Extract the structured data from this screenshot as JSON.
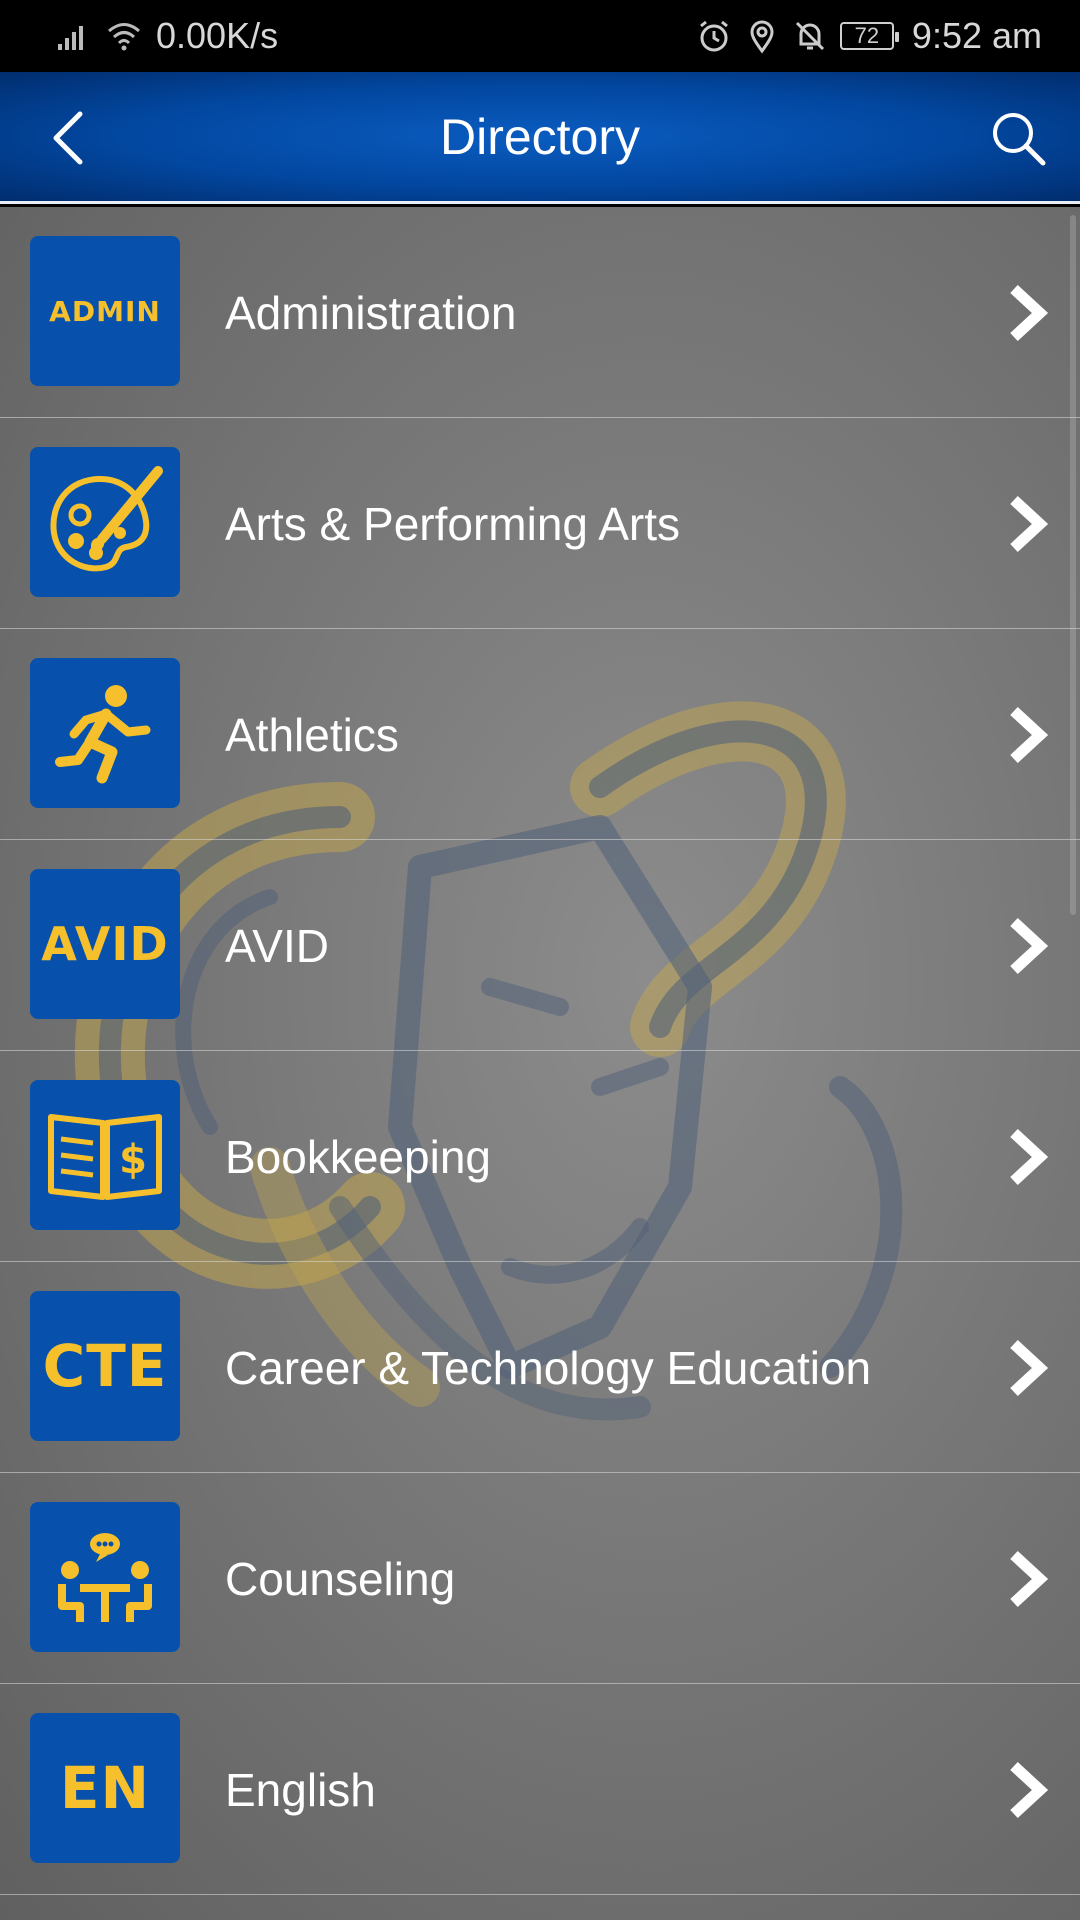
{
  "status_bar": {
    "speed": "0.00K/s",
    "battery": "72",
    "time": "9:52 am"
  },
  "header": {
    "title": "Directory"
  },
  "list": {
    "items": [
      {
        "label": "Administration",
        "icon_text": "ADMIN",
        "icon": "admin-icon"
      },
      {
        "label": "Arts & Performing Arts",
        "icon_text": "",
        "icon": "palette-icon"
      },
      {
        "label": "Athletics",
        "icon_text": "",
        "icon": "runner-icon"
      },
      {
        "label": "AVID",
        "icon_text": "AVID",
        "icon": "avid-icon"
      },
      {
        "label": "Bookkeeping",
        "icon_text": "",
        "icon": "ledger-book-icon"
      },
      {
        "label": "Career & Technology Education",
        "icon_text": "CTE",
        "icon": "cte-icon"
      },
      {
        "label": "Counseling",
        "icon_text": "",
        "icon": "counseling-icon"
      },
      {
        "label": "English",
        "icon_text": "EN",
        "icon": "english-icon"
      }
    ]
  },
  "colors": {
    "header_blue": "#0247a0",
    "icon_blue": "#0751ad",
    "icon_gold": "#f6c02c"
  }
}
